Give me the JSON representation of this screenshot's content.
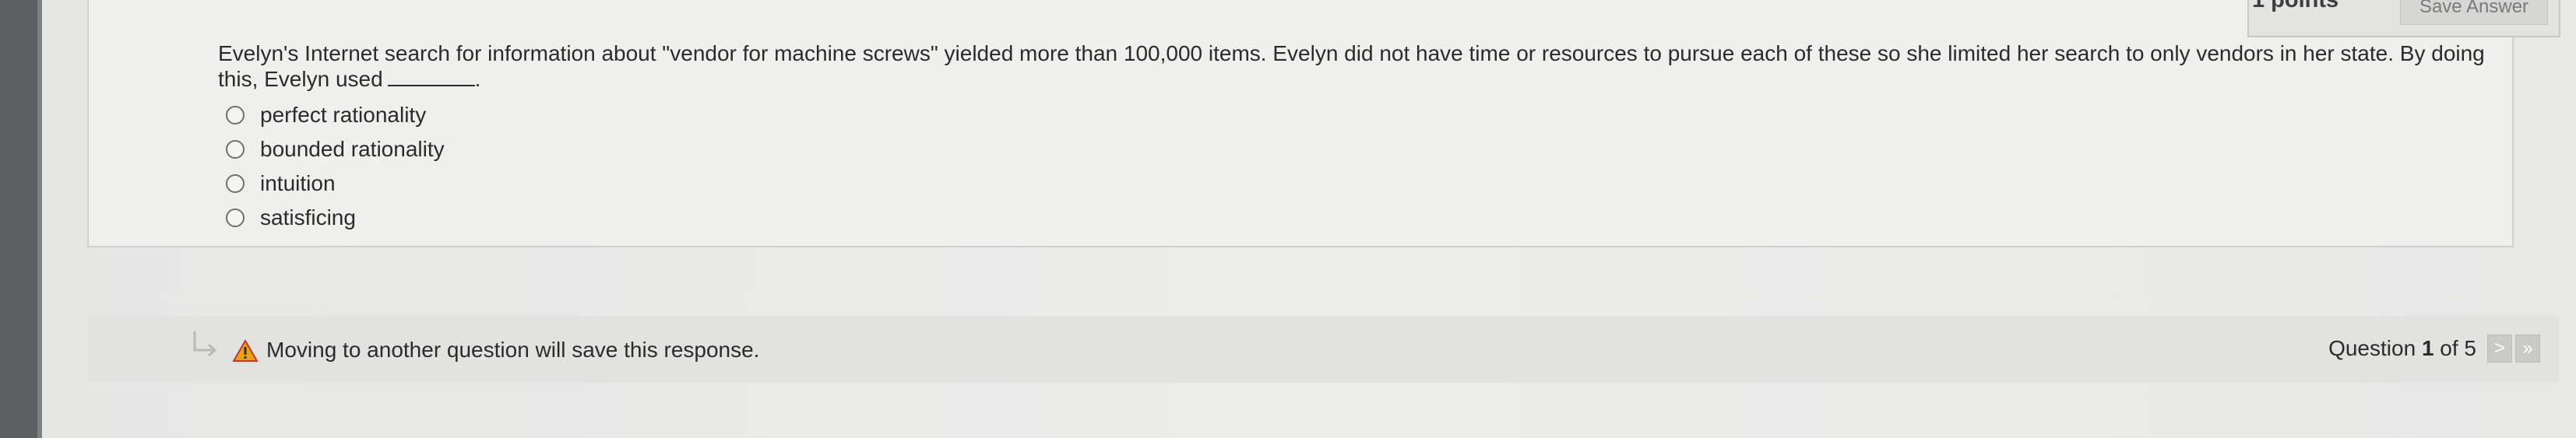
{
  "header": {
    "points_label": "1 points",
    "save_button_label": "Save Answer"
  },
  "question": {
    "prompt": "Evelyn's Internet search for information about \"vendor for machine screws\" yielded more than 100,000 items. Evelyn did not have time or resources to pursue each of these so she limited her search to only vendors in her state. By doing this, Evelyn used",
    "prompt_end": ".",
    "options": [
      {
        "label": "perfect rationality"
      },
      {
        "label": "bounded rationality"
      },
      {
        "label": "intuition"
      },
      {
        "label": "satisficing"
      }
    ]
  },
  "footer": {
    "warning_text": "Moving to another question will save this response.",
    "question_prefix": "Question ",
    "question_current": "1",
    "question_suffix": " of 5",
    "next_label": ">",
    "last_label": "»",
    "warning_icon": "warning-triangle-icon",
    "return_icon": "return-arrow-icon",
    "warning_color": "#e8a11a"
  }
}
